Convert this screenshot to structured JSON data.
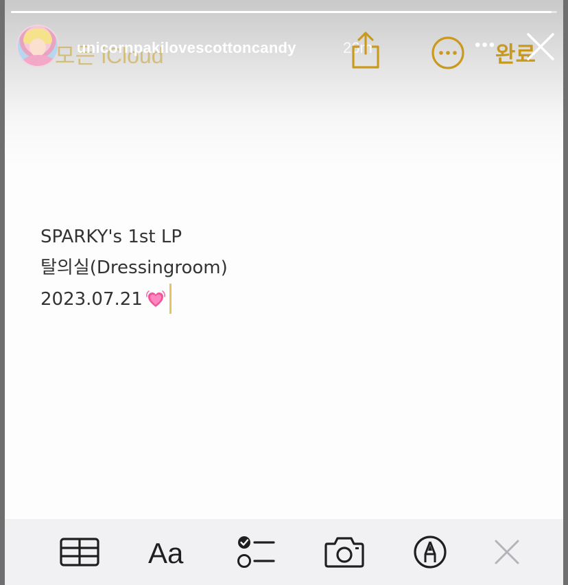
{
  "story": {
    "username": "unicornpakilovescottoncandy",
    "timestamp": "26m",
    "progress": 0.99
  },
  "notes_header": {
    "back_label": "모든 iCloud",
    "done_label": "완료"
  },
  "note": {
    "lines": [
      "SPARKY's 1st LP",
      "탈의실(Dressingroom)",
      "2023.07.21"
    ],
    "emoji": "heart-icon"
  },
  "toolbar": {
    "aa_label": "Aa",
    "items": [
      "table-icon",
      "format-text-button",
      "checklist-icon",
      "camera-icon",
      "markup-pen-icon",
      "close-keyboard-icon"
    ]
  },
  "colors": {
    "accent": "#c79a1f",
    "text": "#333333",
    "toolbar_bg": "#f1f1f3"
  }
}
